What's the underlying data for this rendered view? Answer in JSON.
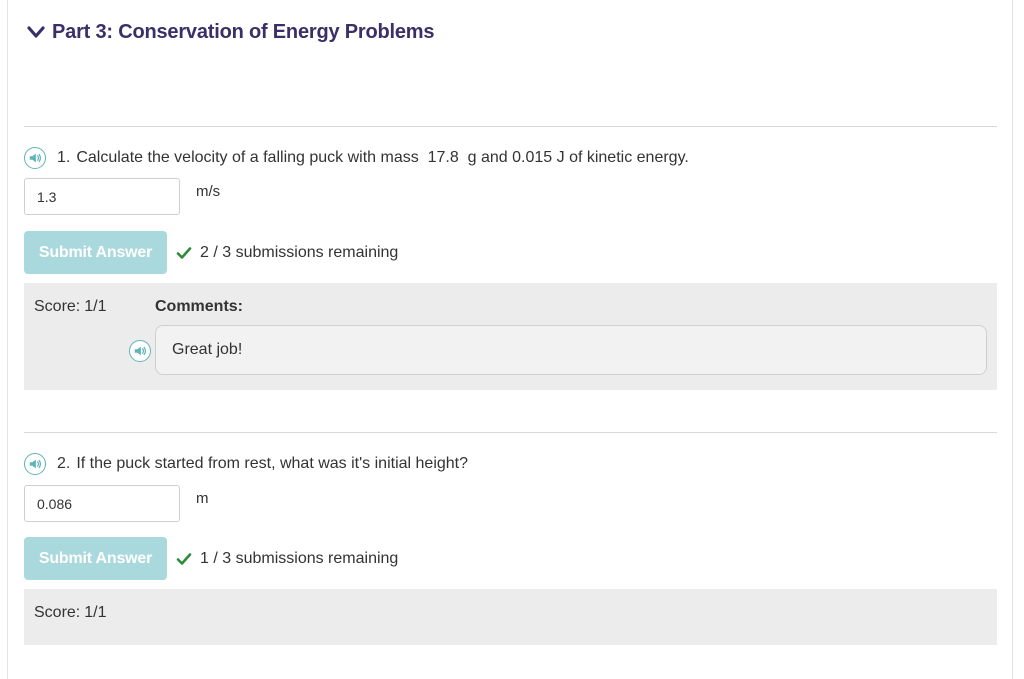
{
  "part": {
    "title": "Part 3: Conservation of Energy Problems",
    "icon": "chevron-down-icon",
    "accent_color": "#3a2f66"
  },
  "questions": [
    {
      "number": "1.",
      "text": "Calculate the velocity of a falling puck with mass  17.8  g and 0.015 J of kinetic energy.",
      "answer_value": "1.3",
      "unit": "m/s",
      "submit_label": "Submit Answer",
      "submissions_text": "2 / 3 submissions remaining",
      "score_label": "Score:",
      "score_value": "1/1",
      "comments_label": "Comments:",
      "comment_text": "Great job!"
    },
    {
      "number": "2.",
      "text": "If the puck started from rest, what was it's initial height?",
      "answer_value": "0.086",
      "unit": "m",
      "submit_label": "Submit Answer",
      "submissions_text": "1 / 3 submissions remaining",
      "score_label": "Score:",
      "score_value": "1/1"
    }
  ],
  "colors": {
    "speaker_teal": "#5fb4b9",
    "submit_disabled": "#a9d9dc",
    "check_green": "#2e8b3c",
    "score_bg": "#ececec"
  }
}
